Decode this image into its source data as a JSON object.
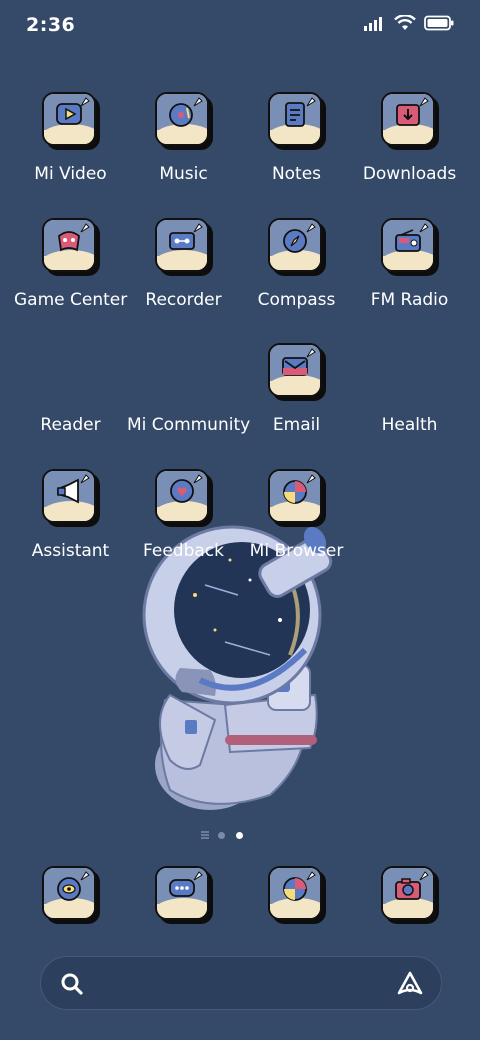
{
  "status": {
    "time": "2:36"
  },
  "rows": [
    [
      {
        "label": "Mi Video"
      },
      {
        "label": "Music"
      },
      {
        "label": "Notes"
      },
      {
        "label": "Downloads"
      }
    ],
    [
      {
        "label": "Game Center"
      },
      {
        "label": "Recorder"
      },
      {
        "label": "Compass"
      },
      {
        "label": "FM Radio"
      }
    ],
    [
      {
        "label": "Reader"
      },
      {
        "label": "Mi Community"
      },
      {
        "label": "Email"
      },
      {
        "label": "Health"
      }
    ],
    [
      {
        "label": "Assistant"
      },
      {
        "label": "Feedback"
      },
      {
        "label": "Mi Browser"
      }
    ]
  ],
  "pages": {
    "count": 2,
    "current": 2
  },
  "colors": {
    "background": "#354a69",
    "tile_sky": "#7a8fb5",
    "tile_cloud": "#f3e6c6"
  }
}
